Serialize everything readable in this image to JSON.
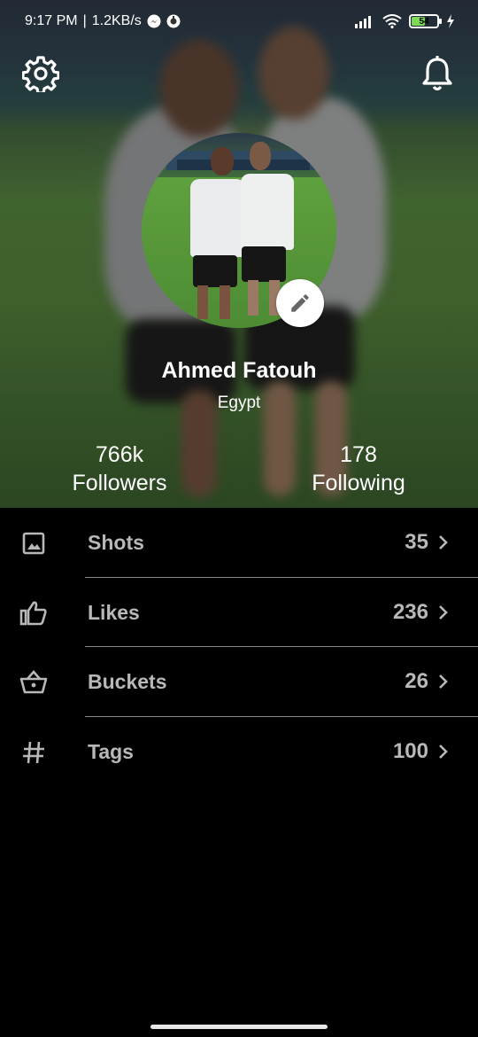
{
  "status_bar": {
    "time": "9:17 PM",
    "separator": "|",
    "net_speed": "1.2KB/s",
    "battery_level": "54"
  },
  "header": {
    "settings_icon": "gear-icon",
    "notifications_icon": "bell-icon",
    "edit_icon": "pencil-icon"
  },
  "profile": {
    "name": "Ahmed Fatouh",
    "country": "Egypt",
    "followers_count": "766k",
    "followers_label": "Followers",
    "following_count": "178",
    "following_label": "Following"
  },
  "menu": [
    {
      "label": "Shots",
      "count": "35",
      "icon": "image-icon"
    },
    {
      "label": "Likes",
      "count": "236",
      "icon": "thumbs-up-icon"
    },
    {
      "label": "Buckets",
      "count": "26",
      "icon": "basket-icon"
    },
    {
      "label": "Tags",
      "count": "100",
      "icon": "hash-icon"
    }
  ],
  "colors": {
    "background": "#000000",
    "list_text": "#b8b8b8",
    "divider": "#8a8a8a",
    "battery": "#7ed957"
  }
}
